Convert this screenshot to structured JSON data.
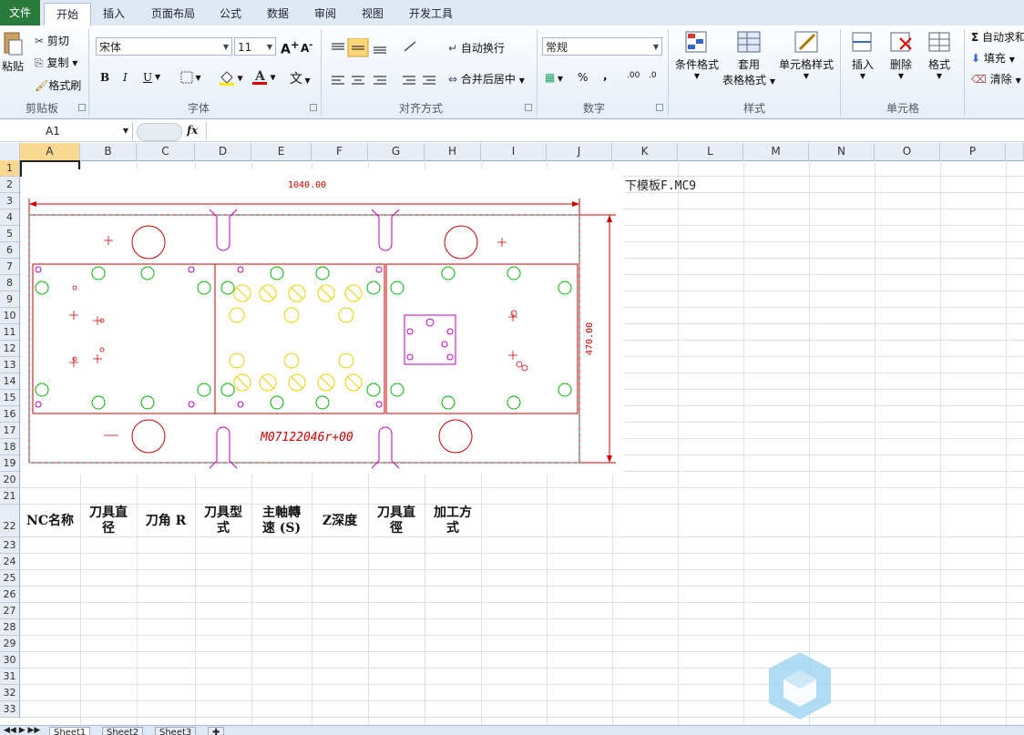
{
  "tabs": [
    "文件",
    "开始",
    "插入",
    "页面布局",
    "公式",
    "数据",
    "审阅",
    "视图",
    "开发工具"
  ],
  "clipboard": {
    "paste": "粘贴",
    "cut": "剪切",
    "copy": "复制",
    "format_painter": "格式刷",
    "label": "剪贴板"
  },
  "font": {
    "name": "宋体",
    "size": "11",
    "label": "字体",
    "bold": "B",
    "italic": "I",
    "underline": "U",
    "grow": "A",
    "shrink": "A"
  },
  "alignment": {
    "wrap": "自动换行",
    "merge": "合并后居中",
    "label": "对齐方式"
  },
  "number": {
    "format": "常规",
    "percent": "%",
    "comma": ",",
    "label": "数字"
  },
  "styles": {
    "conditional": "条件格式",
    "table_line1": "套用",
    "table_line2": "表格格式",
    "cell": "单元格样式",
    "label": "样式"
  },
  "cells": {
    "insert": "插入",
    "delete": "删除",
    "format": "格式",
    "label": "单元格"
  },
  "editing": {
    "autosum": "自动求和",
    "fill": "填充",
    "clear": "清除"
  },
  "formula_bar": {
    "name_box": "A1",
    "fx": "fx"
  },
  "columns": [
    "A",
    "B",
    "C",
    "D",
    "E",
    "F",
    "G",
    "H",
    "I",
    "J",
    "K",
    "L",
    "M",
    "N",
    "O",
    "P"
  ],
  "rows": [
    "1",
    "2",
    "3",
    "4",
    "5",
    "6",
    "7",
    "8",
    "9",
    "10",
    "11",
    "12",
    "13",
    "14",
    "15",
    "16",
    "17",
    "18",
    "19",
    "20",
    "21",
    "22",
    "23",
    "24",
    "25",
    "26",
    "27",
    "28",
    "29",
    "30",
    "31",
    "32",
    "33"
  ],
  "cell_k2": "下模板F.MC9",
  "drawing": {
    "dim_width": "1040.00",
    "dim_height": "470.00",
    "code": "M07122046r+00"
  },
  "header_row": [
    {
      "l1": "NC名称",
      "l2": ""
    },
    {
      "l1": "刀具直",
      "l2": "径"
    },
    {
      "l1": "刀角 R",
      "l2": ""
    },
    {
      "l1": "刀具型",
      "l2": "式"
    },
    {
      "l1": "主軸轉",
      "l2": "速 (S)"
    },
    {
      "l1": "Z深度",
      "l2": ""
    },
    {
      "l1": "刀具直",
      "l2": "徑"
    },
    {
      "l1": "加工方",
      "l2": "式"
    }
  ],
  "sheets": [
    "Sheet1",
    "Sheet2",
    "Sheet3"
  ],
  "colors": {
    "file_tab": "#2a7a3b",
    "drawing_red": "#d00000",
    "drawing_green": "#00b000",
    "drawing_yellow": "#e6d200",
    "drawing_magenta": "#c000c0"
  }
}
